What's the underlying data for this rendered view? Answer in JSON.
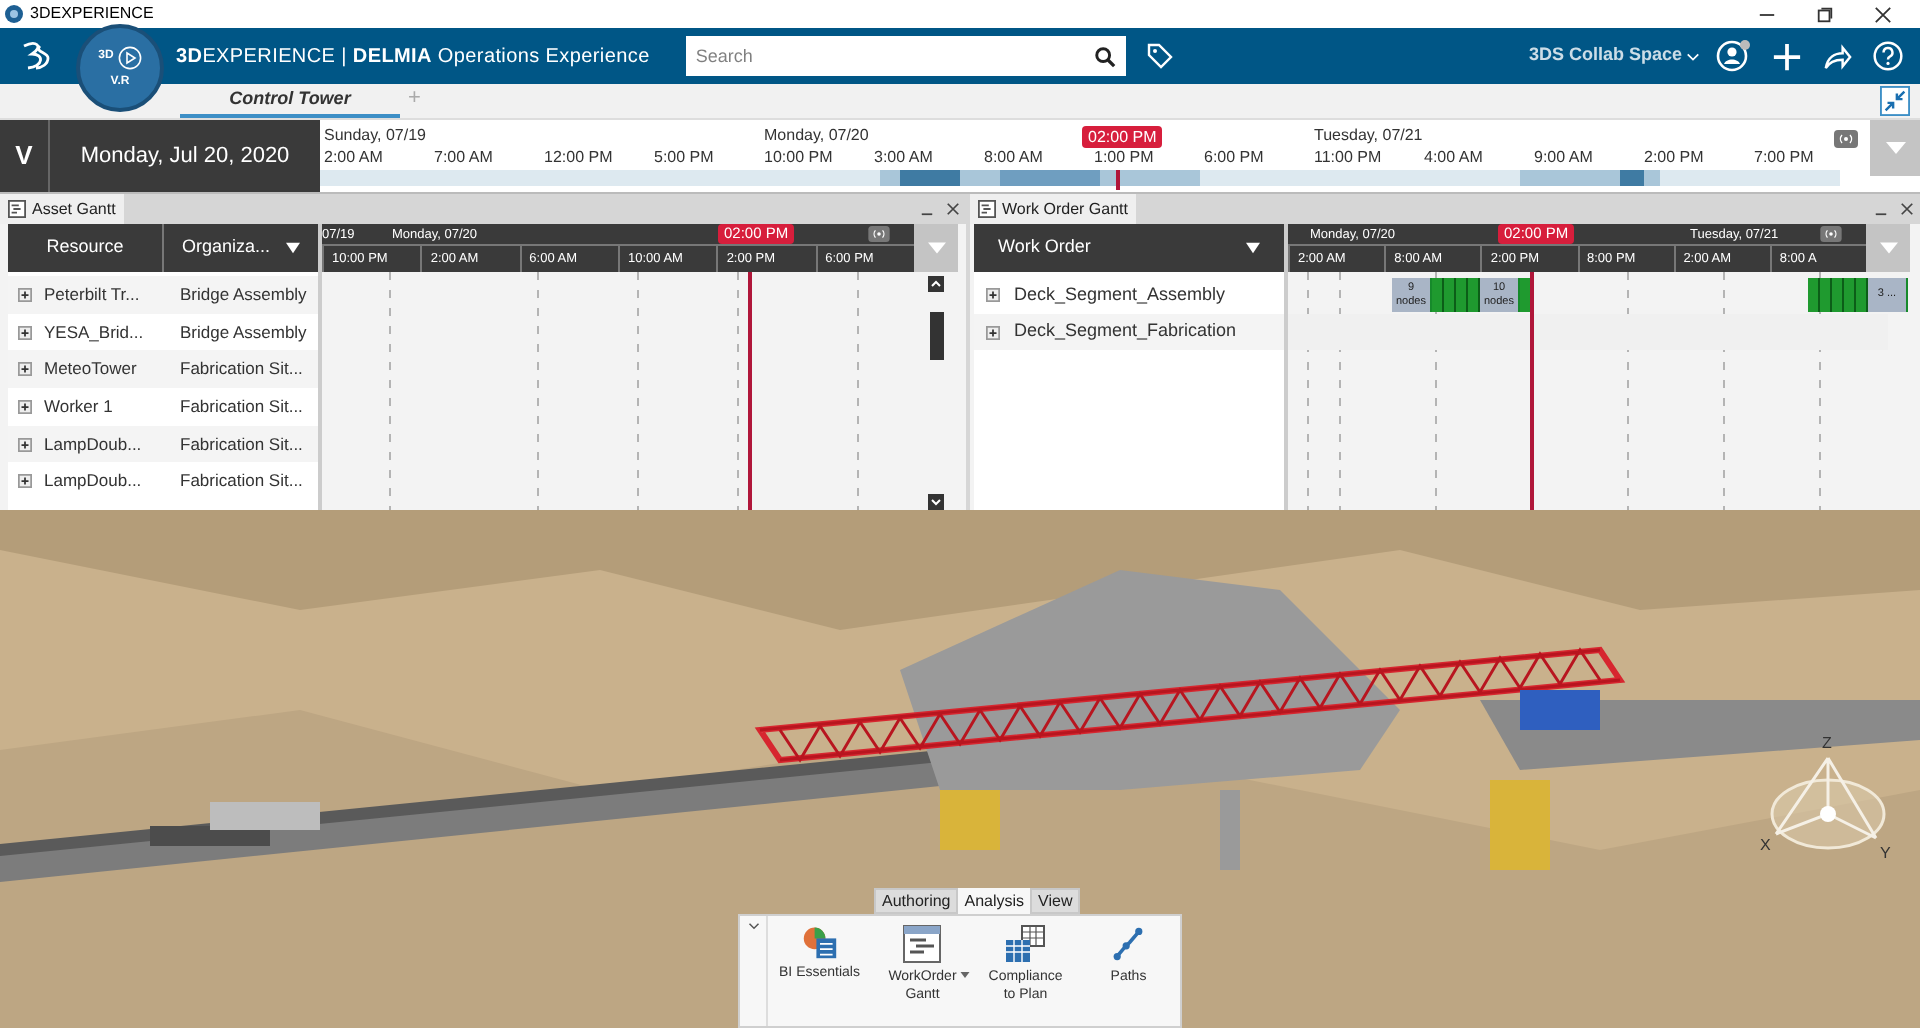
{
  "window": {
    "title": "3DEXPERIENCE"
  },
  "topbar": {
    "brand": "**3D**EXPERIENCE | **DELMIA** Operations Experience",
    "compass": [
      "3D",
      "V.R"
    ],
    "search": {
      "placeholder": "Search"
    },
    "space": "3DS Collab Space"
  },
  "tabs": [
    {
      "label": "Control Tower",
      "selected": true
    }
  ],
  "add_tab": "+",
  "timeline": {
    "toggle": "V",
    "date": "Monday, Jul 20, 2020",
    "marker": "02:00 PM",
    "ticks": [
      {
        "label": "2:00 AM",
        "day": "Sunday, 07/19"
      },
      {
        "label": "7:00 AM"
      },
      {
        "label": "12:00 PM"
      },
      {
        "label": "5:00 PM"
      },
      {
        "label": "10:00 PM",
        "day": "Monday, 07/20"
      },
      {
        "label": "3:00 AM"
      },
      {
        "label": "8:00 AM"
      },
      {
        "label": "1:00 PM"
      },
      {
        "label": "6:00 PM"
      },
      {
        "label": "11:00 PM",
        "day": "Tuesday, 07/21"
      },
      {
        "label": "4:00 AM"
      },
      {
        "label": "9:00 AM"
      },
      {
        "label": "2:00 PM"
      },
      {
        "label": "7:00 PM"
      }
    ]
  },
  "asset_gantt": {
    "title": "Asset Gantt",
    "columns": [
      "Resource",
      "Organiza..."
    ],
    "days": [
      "07/19",
      "Monday, 07/20"
    ],
    "ticks": [
      "10:00 PM",
      "2:00 AM",
      "6:00 AM",
      "10:00 AM",
      "2:00 PM",
      "6:00 PM"
    ],
    "marker": "02:00 PM",
    "rows": [
      {
        "resource": "Peterbilt Tr...",
        "organization": "Bridge Assembly"
      },
      {
        "resource": "YESA_Brid...",
        "organization": "Bridge Assembly"
      },
      {
        "resource": "MeteoTower",
        "organization": "Fabrication Sit..."
      },
      {
        "resource": "Worker 1",
        "organization": "Fabrication Sit..."
      },
      {
        "resource": "LampDoub...",
        "organization": "Fabrication Sit..."
      },
      {
        "resource": "LampDoub...",
        "organization": "Fabrication Sit..."
      }
    ]
  },
  "work_order_gantt": {
    "title": "Work Order Gantt",
    "column": "Work Order",
    "days": [
      "Monday, 07/20",
      "Tuesday, 07/21"
    ],
    "ticks": [
      "2:00 AM",
      "8:00 AM",
      "2:00 PM",
      "8:00 PM",
      "2:00 AM",
      "8:00 A"
    ],
    "marker": "02:00 PM",
    "rows": [
      {
        "name": "Deck_Segment_Assembly",
        "clusters": [
          [
            {
              "kind": "group",
              "label": "9 nodes"
            },
            {
              "kind": "task"
            },
            {
              "kind": "task"
            },
            {
              "kind": "task"
            },
            {
              "kind": "task"
            },
            {
              "kind": "group",
              "label": "10 nodes"
            },
            {
              "kind": "task"
            }
          ],
          [
            {
              "kind": "task"
            },
            {
              "kind": "task"
            },
            {
              "kind": "task"
            },
            {
              "kind": "task"
            },
            {
              "kind": "task"
            },
            {
              "kind": "group",
              "label": "3 ..."
            }
          ]
        ]
      },
      {
        "name": "Deck_Segment_Fabrication",
        "clusters": []
      }
    ]
  },
  "scene": {
    "axes": [
      "Z",
      "X",
      "Y"
    ]
  },
  "ribbon": {
    "tabs": [
      {
        "label": "Authoring",
        "selected": false
      },
      {
        "label": "Analysis",
        "selected": true
      },
      {
        "label": "View",
        "selected": false
      }
    ],
    "tools": [
      {
        "label": "BI Essentials",
        "kind": "bi"
      },
      {
        "label": "WorkOrder Gantt",
        "kind": "gantt",
        "dropdown": true
      },
      {
        "label": "Compliance to Plan",
        "kind": "compliance"
      },
      {
        "label": "Paths",
        "kind": "paths"
      }
    ]
  }
}
